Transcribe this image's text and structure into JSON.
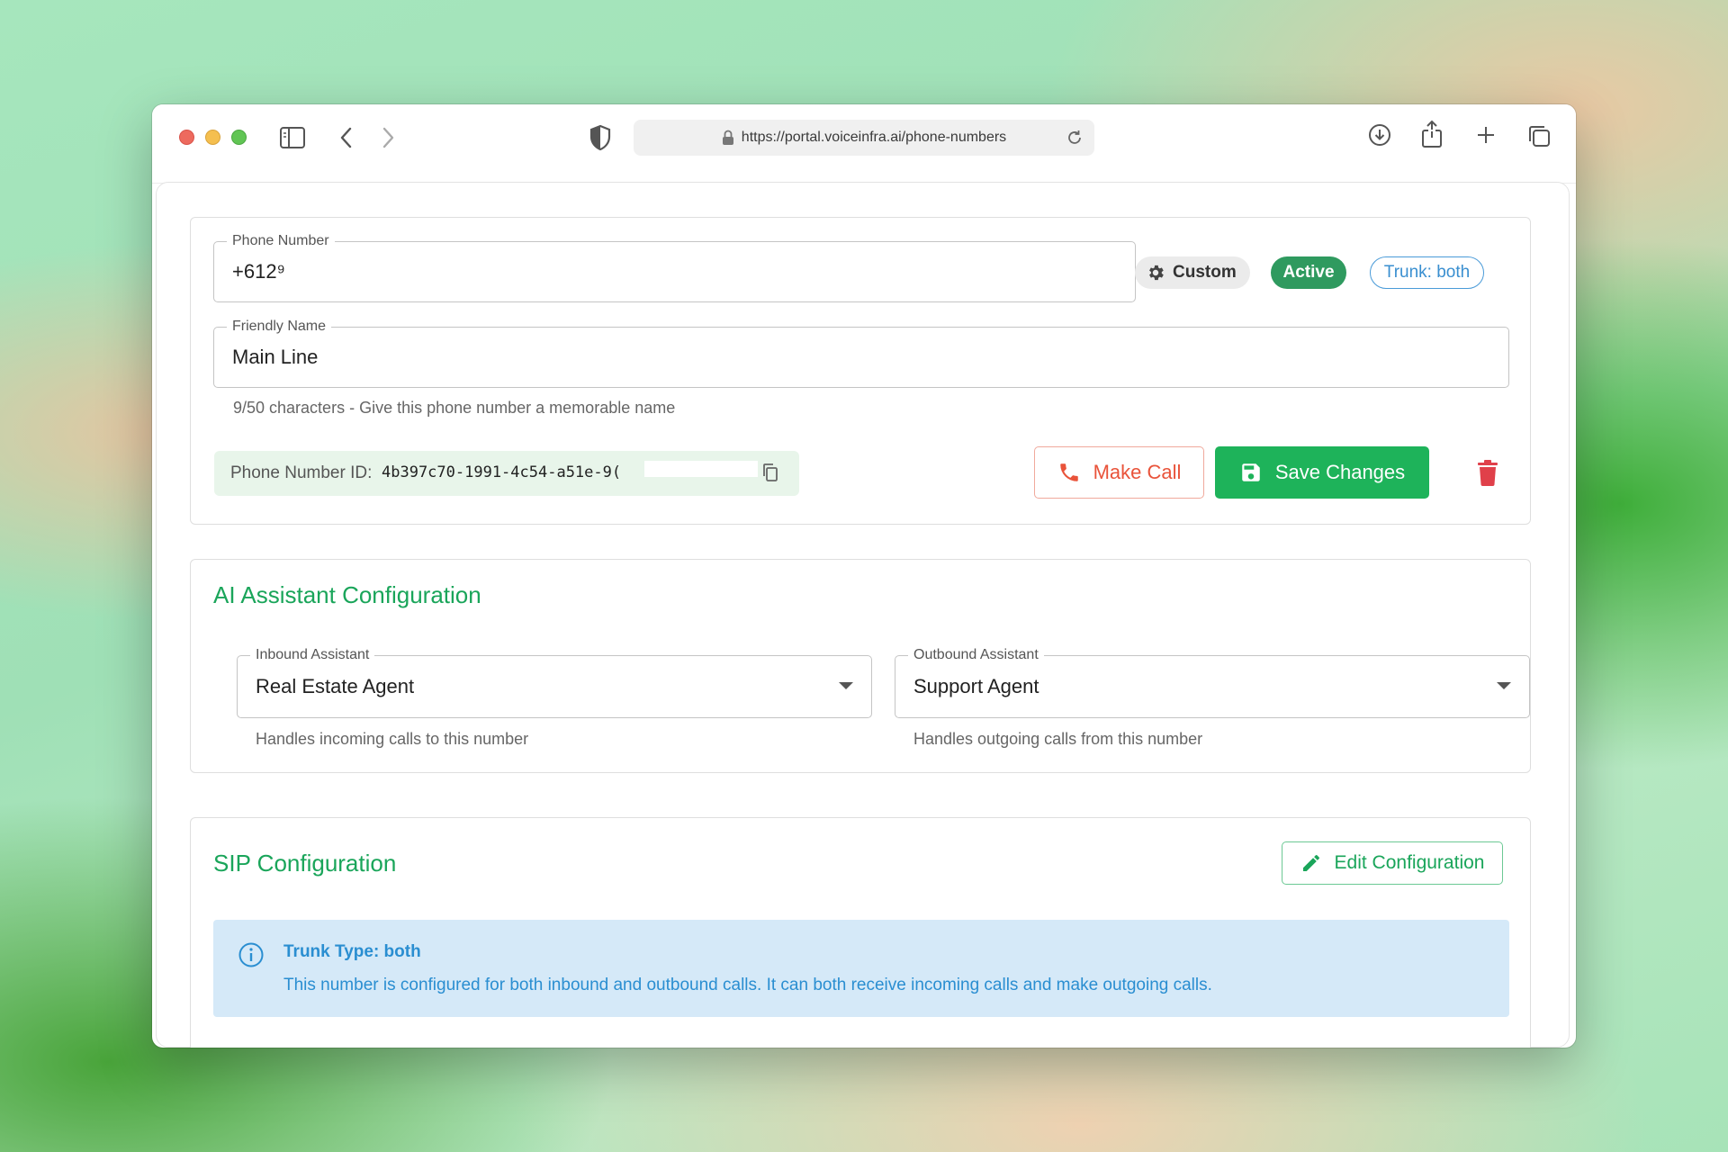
{
  "browser": {
    "url": "https://portal.voiceinfra.ai/phone-numbers"
  },
  "phone_number": {
    "label": "Phone Number",
    "value": "+612⁹"
  },
  "chips": {
    "custom": "Custom",
    "status": "Active",
    "trunk": "Trunk: both"
  },
  "friendly_name": {
    "label": "Friendly Name",
    "value": "Main Line",
    "helper": "9/50 characters - Give this phone number a memorable name"
  },
  "phone_id": {
    "label": "Phone Number ID:",
    "value": "4b397c70-1991-4c54-a51e-9("
  },
  "actions": {
    "make_call": "Make Call",
    "save_changes": "Save Changes"
  },
  "ai_config": {
    "title": "AI Assistant Configuration",
    "inbound": {
      "label": "Inbound Assistant",
      "value": "Real Estate Agent",
      "helper": "Handles incoming calls to this number"
    },
    "outbound": {
      "label": "Outbound Assistant",
      "value": "Support Agent",
      "helper": "Handles outgoing calls from this number"
    }
  },
  "sip_config": {
    "title": "SIP Configuration",
    "edit_button": "Edit Configuration",
    "info_title": "Trunk Type: both",
    "info_text": "This number is configured for both inbound and outbound calls. It can both receive incoming calls and make outgoing calls."
  },
  "colors": {
    "accent_green": "#1eb35a",
    "active_chip": "#2f9a5f",
    "danger": "#e9533a",
    "info_blue": "#2a8ed1"
  }
}
